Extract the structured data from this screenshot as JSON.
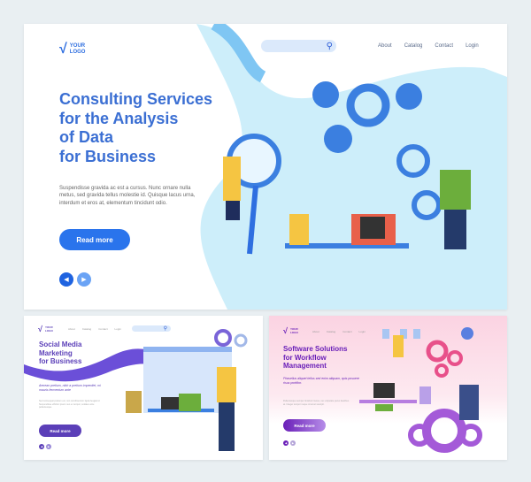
{
  "nav": [
    "About",
    "Catalog",
    "Contact",
    "Login"
  ],
  "logo": {
    "line1": "YOUR",
    "line2": "LOGO"
  },
  "hero": {
    "title": [
      "Consulting Services",
      "for the Analysis",
      "of Data",
      "for Business"
    ],
    "body": "Suspendisse gravida ac est a cursus. Nunc ornare nulla metus, sed gravida tellus molestie id. Quisque lacus urna, interdum et eros at, elementum tincidunt odio.",
    "button": "Read more",
    "accent": "#2f6fe0"
  },
  "social": {
    "title": [
      "Social Media",
      "Marketing",
      "for Business"
    ],
    "subtitle": "Aenean pretium, nibh a pretium imperdiet, mi mauris fermentum ante",
    "body": "Sed consequat pretium est, non condimentum ligula feugiat id. Suspendisse efficitur ipsum nec ex tempor, sodales ante pellentesque.",
    "button": "Read more",
    "accent": "#5b3fb8"
  },
  "software": {
    "title": [
      "Software Solutions",
      "for Workflow",
      "Management"
    ],
    "subtitle": "Phasellus aliquet tellus sed enim aliquam, quis posuere risus porttitor.",
    "body": "Pellentesque semper tincidunt metus, nec vulputate purus faucibus at. Integer tempor neque sit amet suscipit.",
    "button": "Read more",
    "accent": "#6a1fb8"
  },
  "icons": {
    "search": "search-icon",
    "prev": "chevron-left-icon",
    "next": "chevron-right-icon",
    "logo": "checkmark-icon"
  }
}
